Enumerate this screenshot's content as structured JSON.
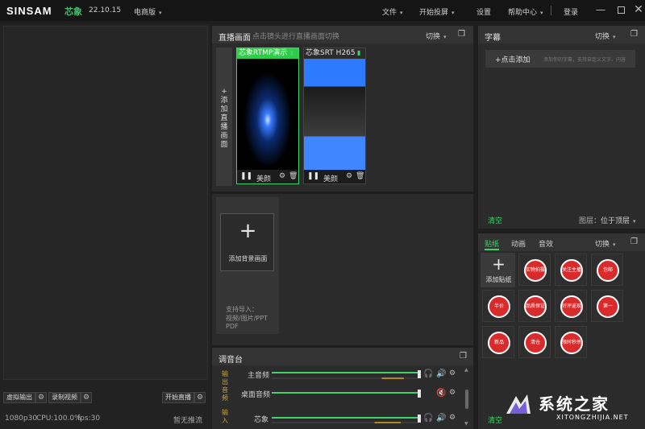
{
  "app": {
    "brand": "SINSAM",
    "brand_cn": "芯象",
    "version": "22.10.15",
    "edition": "电商版"
  },
  "menubar": {
    "file": "文件",
    "start_cast": "开始投屏",
    "settings": "设置",
    "help": "帮助中心",
    "login": "登录"
  },
  "left": {
    "virtual_output": "虚拟输出",
    "record_video": "录制视频",
    "start_live": "开始直播",
    "status_res": "1080p30",
    "status_cpu": "CPU:100.0%",
    "status_fps": "fps:30",
    "status_stream": "暂无推流"
  },
  "live": {
    "title": "直播画面",
    "hint": "点击镜头进行直播画面切换",
    "switch": "切换",
    "add_vertical": [
      "+",
      "添",
      "加",
      "直",
      "播",
      "画",
      "面"
    ],
    "tiles": [
      {
        "label": "芯象RTMP演示",
        "beauty": "美颜"
      },
      {
        "label": "芯象SRT H265",
        "beauty": "美颜"
      }
    ]
  },
  "background": {
    "plus": "+",
    "add_label": "添加背景画面",
    "support_title": "支持导入：",
    "support_line1": "视频/图片/PPT",
    "support_line2": "PDF"
  },
  "mixer": {
    "title": "调音台",
    "output_group": [
      "输",
      "出",
      "音",
      "频"
    ],
    "input_group": [
      "输",
      "入"
    ],
    "channels": [
      {
        "name": "主音频",
        "level": 1.0
      },
      {
        "name": "桌面音频",
        "level": 1.0
      },
      {
        "name": "芯象",
        "level": 1.0
      }
    ]
  },
  "subtitle": {
    "title": "字幕",
    "switch": "切换",
    "add_btn": "+点击添加",
    "add_hint": "添加你的字幕，支持自定义文字、内容",
    "clear": "清空",
    "layer_label": "图层：",
    "layer_value": "位于顶层"
  },
  "stickers": {
    "tabs": [
      "贴纸",
      "动画",
      "音效"
    ],
    "switch": "切换",
    "add_label": "添加贴纸",
    "clear": "清空",
    "items": [
      "实物拍摄",
      "关注主播福利多多",
      "包邮",
      "半价",
      "品质保证",
      "好评返现",
      "第一",
      "新品",
      "清仓",
      "限时秒杀"
    ]
  },
  "watermark": {
    "brand": "系统之家",
    "domain": "XITONGZHIJIA.NET"
  },
  "colors": {
    "accent_green": "#3fd26a",
    "panel": "#2b2b2b",
    "background": "#1e1e1e",
    "sticker_red": "#d92b2b"
  }
}
